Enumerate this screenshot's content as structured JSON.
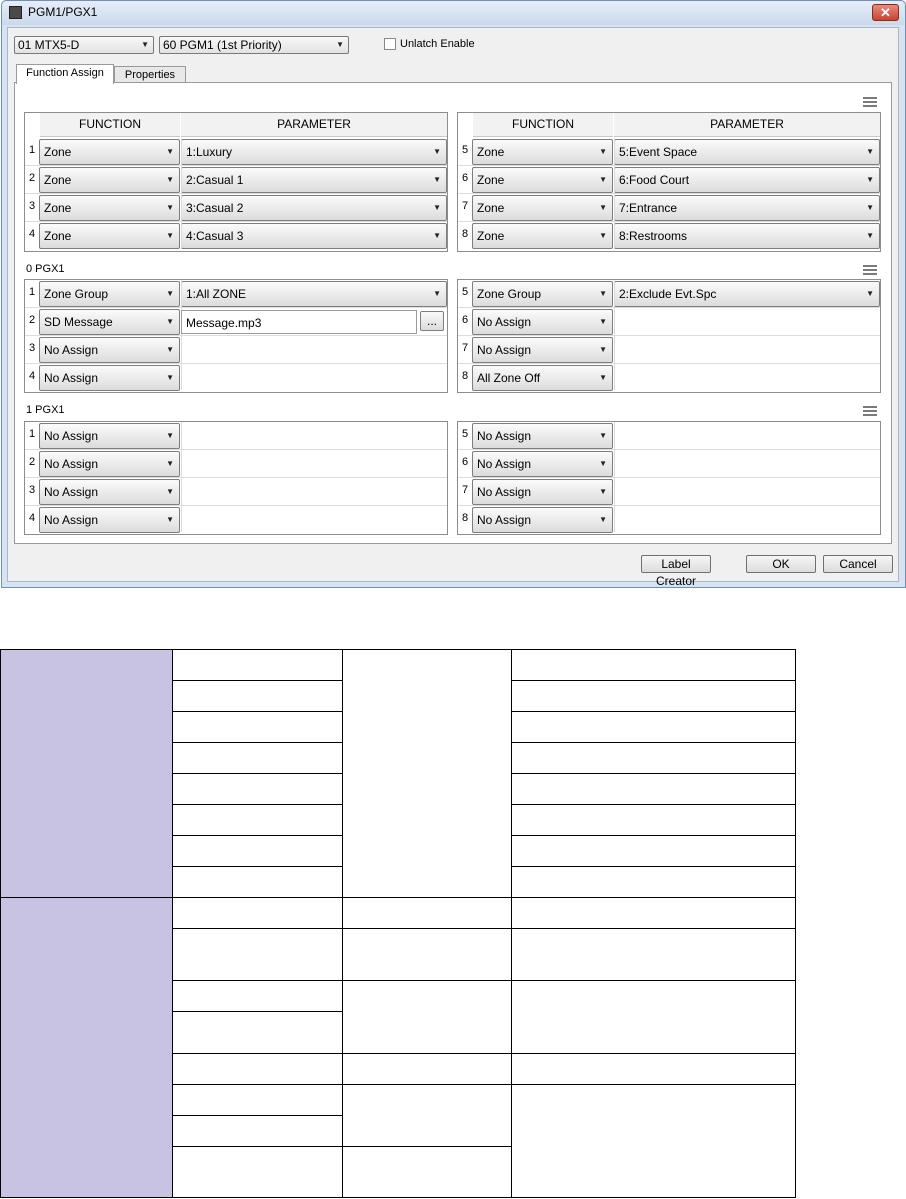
{
  "window": {
    "title": "PGM1/PGX1",
    "close_glyph": "✕"
  },
  "toolbar": {
    "device_combo": "01 MTX5-D",
    "pgm_combo": "60 PGM1 (1st Priority)",
    "unlatch_label": "Unlatch Enable",
    "unlatch_checked": false
  },
  "tabs": [
    {
      "label": "Function Assign",
      "active": true
    },
    {
      "label": "Properties",
      "active": false
    }
  ],
  "headers": {
    "function": "FUNCTION",
    "parameter": "PARAMETER"
  },
  "pgm1": {
    "left": [
      {
        "num": "1",
        "function": "Zone",
        "parameter": "1:Luxury"
      },
      {
        "num": "2",
        "function": "Zone",
        "parameter": "2:Casual 1"
      },
      {
        "num": "3",
        "function": "Zone",
        "parameter": "3:Casual 2"
      },
      {
        "num": "4",
        "function": "Zone",
        "parameter": "4:Casual 3"
      }
    ],
    "right": [
      {
        "num": "5",
        "function": "Zone",
        "parameter": "5:Event Space"
      },
      {
        "num": "6",
        "function": "Zone",
        "parameter": "6:Food Court"
      },
      {
        "num": "7",
        "function": "Zone",
        "parameter": "7:Entrance"
      },
      {
        "num": "8",
        "function": "Zone",
        "parameter": "8:Restrooms"
      }
    ]
  },
  "pgx0": {
    "label": "0 PGX1",
    "left": [
      {
        "num": "1",
        "function": "Zone Group",
        "parameter": "1:All ZONE"
      },
      {
        "num": "2",
        "function": "SD Message",
        "parameter": "Message.mp3",
        "button": "..."
      },
      {
        "num": "3",
        "function": "No Assign",
        "parameter": ""
      },
      {
        "num": "4",
        "function": "No Assign",
        "parameter": ""
      }
    ],
    "right": [
      {
        "num": "5",
        "function": "Zone Group",
        "parameter": "2:Exclude Evt.Spc"
      },
      {
        "num": "6",
        "function": "No Assign",
        "parameter": ""
      },
      {
        "num": "7",
        "function": "No Assign",
        "parameter": ""
      },
      {
        "num": "8",
        "function": "All Zone Off",
        "parameter": ""
      }
    ]
  },
  "pgx1": {
    "label": "1 PGX1",
    "left": [
      {
        "num": "1",
        "function": "No Assign"
      },
      {
        "num": "2",
        "function": "No Assign"
      },
      {
        "num": "3",
        "function": "No Assign"
      },
      {
        "num": "4",
        "function": "No Assign"
      }
    ],
    "right": [
      {
        "num": "5",
        "function": "No Assign"
      },
      {
        "num": "6",
        "function": "No Assign"
      },
      {
        "num": "7",
        "function": "No Assign"
      },
      {
        "num": "8",
        "function": "No Assign"
      }
    ]
  },
  "buttons": {
    "label_creator": "Label Creator",
    "ok": "OK",
    "cancel": "Cancel"
  },
  "icons": {
    "dropdown": "▼",
    "menu": "hamburger-menu-icon"
  },
  "colors": {
    "purple_cell": "#c9c3e3",
    "window_frame": "#d7e3f1",
    "close_red": "#c9432f"
  }
}
